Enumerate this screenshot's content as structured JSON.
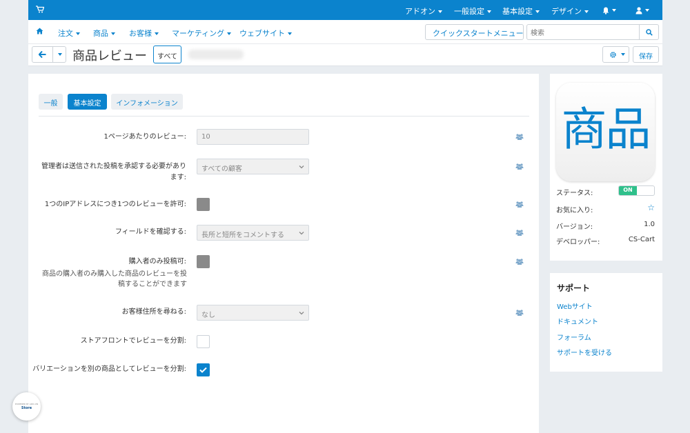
{
  "topbar": {
    "menus": [
      "アドオン",
      "一般設定",
      "基本設定",
      "デザイン"
    ]
  },
  "nav": {
    "items": [
      "注文",
      "商品",
      "お客様",
      "マーケティング",
      "ウェブサイト"
    ],
    "quickstart_label": "クイックスタートメニュー",
    "search_placeholder": "検索"
  },
  "titlebar": {
    "title": "商品レビュー",
    "all_label": "すべて",
    "save_label": "保存"
  },
  "tabs": [
    {
      "label": "一般",
      "active": false
    },
    {
      "label": "基本設定",
      "active": true
    },
    {
      "label": "インフォメーション",
      "active": false
    }
  ],
  "fields": {
    "reviews_per_page": {
      "label": "1ページあたりのレビュー:",
      "value": "10"
    },
    "approval": {
      "label": "管理者は送信された投稿を承認する必要があります:",
      "value": "すべての顧客"
    },
    "one_per_ip": {
      "label": "1つのIPアドレスにつき1つのレビューを許可:",
      "checked": false
    },
    "confirm_fields": {
      "label": "フィールドを確認する:",
      "value": "長所と短所をコメントする"
    },
    "buyers_only": {
      "label": "購入者のみ投稿可:",
      "hint": "商品の購入者のみ購入した商品のレビューを投稿することができます",
      "checked": false
    },
    "ask_address": {
      "label": "お客様住所を尋ねる:",
      "value": "なし"
    },
    "split_storefront": {
      "label": "ストアフロントでレビューを分割:",
      "checked": false
    },
    "split_variations": {
      "label": "バリエーションを別の商品としてレビューを分割:",
      "checked": true
    }
  },
  "addon": {
    "logo_text": "商品",
    "status_label": "ステータス:",
    "status_value": "ON",
    "favorite_label": "お気に入り:",
    "version_label": "バージョン:",
    "version_value": "1.0",
    "developer_label": "デベロッパー:",
    "developer_value": "CS-Cart"
  },
  "support": {
    "title": "サポート",
    "links": [
      "Webサイト",
      "ドキュメント",
      "フォーラム",
      "サポートを受ける"
    ]
  },
  "badge": {
    "line1": "POWERED BY ADD-ON",
    "line2": "Store"
  },
  "colors": {
    "accent": "#0b83cd",
    "toggle_on": "#2fc08b"
  }
}
